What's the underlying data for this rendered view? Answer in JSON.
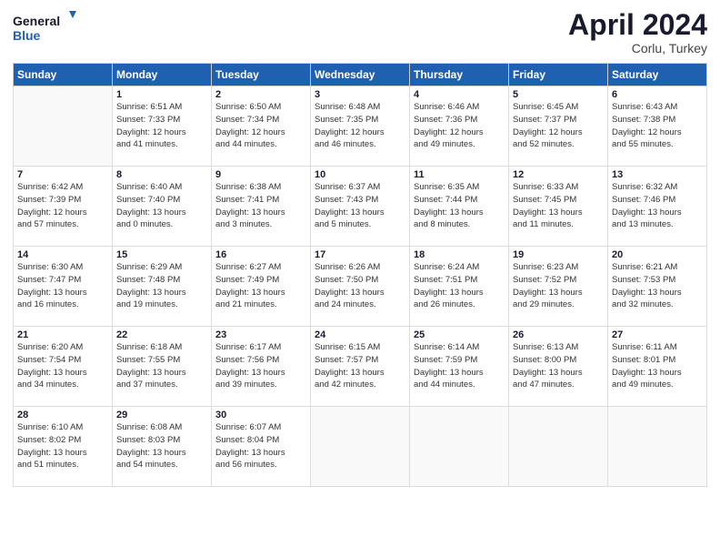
{
  "header": {
    "logo_line1": "General",
    "logo_line2": "Blue",
    "month_title": "April 2024",
    "subtitle": "Corlu, Turkey"
  },
  "weekdays": [
    "Sunday",
    "Monday",
    "Tuesday",
    "Wednesday",
    "Thursday",
    "Friday",
    "Saturday"
  ],
  "weeks": [
    [
      {
        "day": "",
        "info": ""
      },
      {
        "day": "1",
        "info": "Sunrise: 6:51 AM\nSunset: 7:33 PM\nDaylight: 12 hours\nand 41 minutes."
      },
      {
        "day": "2",
        "info": "Sunrise: 6:50 AM\nSunset: 7:34 PM\nDaylight: 12 hours\nand 44 minutes."
      },
      {
        "day": "3",
        "info": "Sunrise: 6:48 AM\nSunset: 7:35 PM\nDaylight: 12 hours\nand 46 minutes."
      },
      {
        "day": "4",
        "info": "Sunrise: 6:46 AM\nSunset: 7:36 PM\nDaylight: 12 hours\nand 49 minutes."
      },
      {
        "day": "5",
        "info": "Sunrise: 6:45 AM\nSunset: 7:37 PM\nDaylight: 12 hours\nand 52 minutes."
      },
      {
        "day": "6",
        "info": "Sunrise: 6:43 AM\nSunset: 7:38 PM\nDaylight: 12 hours\nand 55 minutes."
      }
    ],
    [
      {
        "day": "7",
        "info": "Sunrise: 6:42 AM\nSunset: 7:39 PM\nDaylight: 12 hours\nand 57 minutes."
      },
      {
        "day": "8",
        "info": "Sunrise: 6:40 AM\nSunset: 7:40 PM\nDaylight: 13 hours\nand 0 minutes."
      },
      {
        "day": "9",
        "info": "Sunrise: 6:38 AM\nSunset: 7:41 PM\nDaylight: 13 hours\nand 3 minutes."
      },
      {
        "day": "10",
        "info": "Sunrise: 6:37 AM\nSunset: 7:43 PM\nDaylight: 13 hours\nand 5 minutes."
      },
      {
        "day": "11",
        "info": "Sunrise: 6:35 AM\nSunset: 7:44 PM\nDaylight: 13 hours\nand 8 minutes."
      },
      {
        "day": "12",
        "info": "Sunrise: 6:33 AM\nSunset: 7:45 PM\nDaylight: 13 hours\nand 11 minutes."
      },
      {
        "day": "13",
        "info": "Sunrise: 6:32 AM\nSunset: 7:46 PM\nDaylight: 13 hours\nand 13 minutes."
      }
    ],
    [
      {
        "day": "14",
        "info": "Sunrise: 6:30 AM\nSunset: 7:47 PM\nDaylight: 13 hours\nand 16 minutes."
      },
      {
        "day": "15",
        "info": "Sunrise: 6:29 AM\nSunset: 7:48 PM\nDaylight: 13 hours\nand 19 minutes."
      },
      {
        "day": "16",
        "info": "Sunrise: 6:27 AM\nSunset: 7:49 PM\nDaylight: 13 hours\nand 21 minutes."
      },
      {
        "day": "17",
        "info": "Sunrise: 6:26 AM\nSunset: 7:50 PM\nDaylight: 13 hours\nand 24 minutes."
      },
      {
        "day": "18",
        "info": "Sunrise: 6:24 AM\nSunset: 7:51 PM\nDaylight: 13 hours\nand 26 minutes."
      },
      {
        "day": "19",
        "info": "Sunrise: 6:23 AM\nSunset: 7:52 PM\nDaylight: 13 hours\nand 29 minutes."
      },
      {
        "day": "20",
        "info": "Sunrise: 6:21 AM\nSunset: 7:53 PM\nDaylight: 13 hours\nand 32 minutes."
      }
    ],
    [
      {
        "day": "21",
        "info": "Sunrise: 6:20 AM\nSunset: 7:54 PM\nDaylight: 13 hours\nand 34 minutes."
      },
      {
        "day": "22",
        "info": "Sunrise: 6:18 AM\nSunset: 7:55 PM\nDaylight: 13 hours\nand 37 minutes."
      },
      {
        "day": "23",
        "info": "Sunrise: 6:17 AM\nSunset: 7:56 PM\nDaylight: 13 hours\nand 39 minutes."
      },
      {
        "day": "24",
        "info": "Sunrise: 6:15 AM\nSunset: 7:57 PM\nDaylight: 13 hours\nand 42 minutes."
      },
      {
        "day": "25",
        "info": "Sunrise: 6:14 AM\nSunset: 7:59 PM\nDaylight: 13 hours\nand 44 minutes."
      },
      {
        "day": "26",
        "info": "Sunrise: 6:13 AM\nSunset: 8:00 PM\nDaylight: 13 hours\nand 47 minutes."
      },
      {
        "day": "27",
        "info": "Sunrise: 6:11 AM\nSunset: 8:01 PM\nDaylight: 13 hours\nand 49 minutes."
      }
    ],
    [
      {
        "day": "28",
        "info": "Sunrise: 6:10 AM\nSunset: 8:02 PM\nDaylight: 13 hours\nand 51 minutes."
      },
      {
        "day": "29",
        "info": "Sunrise: 6:08 AM\nSunset: 8:03 PM\nDaylight: 13 hours\nand 54 minutes."
      },
      {
        "day": "30",
        "info": "Sunrise: 6:07 AM\nSunset: 8:04 PM\nDaylight: 13 hours\nand 56 minutes."
      },
      {
        "day": "",
        "info": ""
      },
      {
        "day": "",
        "info": ""
      },
      {
        "day": "",
        "info": ""
      },
      {
        "day": "",
        "info": ""
      }
    ]
  ]
}
